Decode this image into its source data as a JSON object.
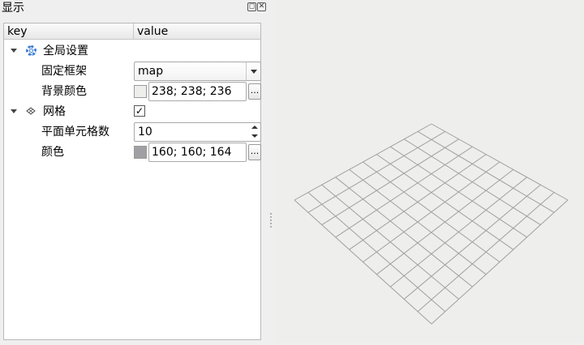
{
  "dock": {
    "title": "显示",
    "float_icon": "float-icon",
    "close_icon": "close-icon"
  },
  "tree": {
    "header": {
      "key": "key",
      "value": "value"
    },
    "global": {
      "label": "全局设置",
      "icon": "gear-icon",
      "fixed_frame": {
        "label": "固定框架",
        "value": "map"
      },
      "background": {
        "label": "背景颜色",
        "value": "238; 238; 236",
        "swatch": "#eeeeec"
      }
    },
    "grid": {
      "label": "网格",
      "icon": "grid-icon",
      "enabled_mark": "✓",
      "cell_count": {
        "label": "平面单元格数",
        "value": "10"
      },
      "color": {
        "label": "颜色",
        "value": "160; 160; 164",
        "swatch": "#a0a0a4"
      }
    },
    "dots_label": "..."
  },
  "viewport": {
    "grid_color": "#a0a0a4",
    "cells": 10,
    "background": "#eeeeec"
  }
}
